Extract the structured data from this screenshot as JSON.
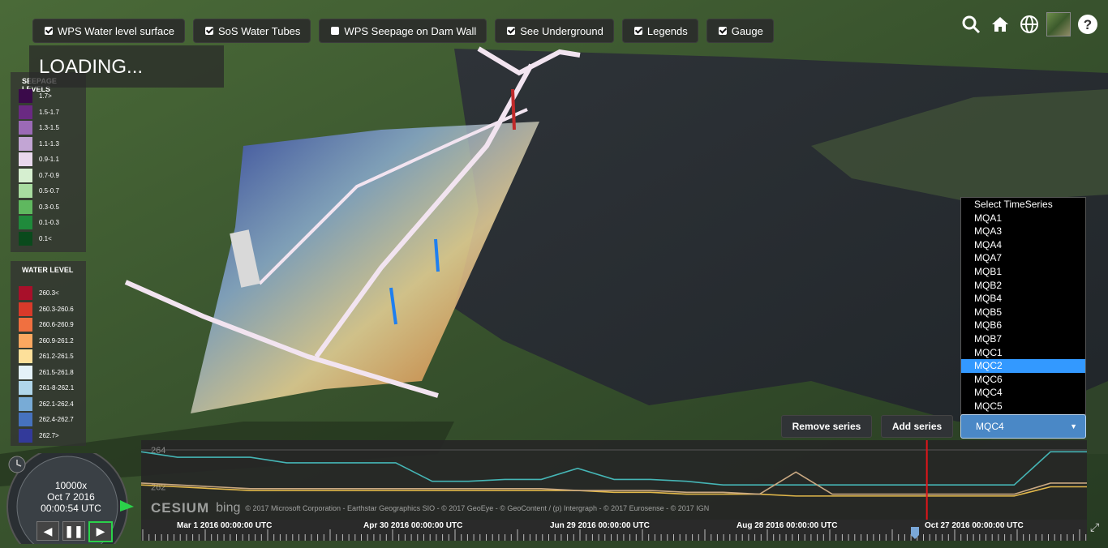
{
  "toolbar": {
    "buttons": [
      {
        "label": "WPS Water level surface",
        "checked": true
      },
      {
        "label": "SoS Water Tubes",
        "checked": true
      },
      {
        "label": "WPS Seepage on Dam Wall",
        "checked": false
      },
      {
        "label": "See Underground",
        "checked": true
      },
      {
        "label": "Legends",
        "checked": true
      },
      {
        "label": "Gauge",
        "checked": true
      }
    ]
  },
  "loading_text": "LOADING...",
  "seepage_legend": {
    "title": "SEEPAGE LEVELS",
    "items": [
      {
        "label": "1.7>",
        "color": "#3a0a4a"
      },
      {
        "label": "1.5-1.7",
        "color": "#6a2a82"
      },
      {
        "label": "1.3-1.5",
        "color": "#9b6ab6"
      },
      {
        "label": "1.1-1.3",
        "color": "#c2a5d4"
      },
      {
        "label": "0.9-1.1",
        "color": "#e8d8ec"
      },
      {
        "label": "0.7-0.9",
        "color": "#d6efd0"
      },
      {
        "label": "0.5-0.7",
        "color": "#a8dca0"
      },
      {
        "label": "0.3-0.5",
        "color": "#5fb85f"
      },
      {
        "label": "0.1-0.3",
        "color": "#1f8a3b"
      },
      {
        "label": "0.1<",
        "color": "#0a4a1c"
      }
    ]
  },
  "water_legend": {
    "title": "WATER LEVEL",
    "items": [
      {
        "label": "260.3<",
        "color": "#a8102a"
      },
      {
        "label": "260.3-260.6",
        "color": "#d83a2a"
      },
      {
        "label": "260.6-260.9",
        "color": "#f07040"
      },
      {
        "label": "260.9-261.2",
        "color": "#fba860"
      },
      {
        "label": "261.2-261.5",
        "color": "#fde09a"
      },
      {
        "label": "261.5-261.8",
        "color": "#e4f2f8"
      },
      {
        "label": "261-8-262.1",
        "color": "#b0d6ea"
      },
      {
        "label": "262.1-262.4",
        "color": "#78abd6"
      },
      {
        "label": "262.4-262.7",
        "color": "#4672be"
      },
      {
        "label": "262.7>",
        "color": "#333a9a"
      }
    ]
  },
  "top_icons": [
    "search-icon",
    "home-icon",
    "globe-icon",
    "imagery-icon",
    "help-icon"
  ],
  "timeseries": {
    "options": [
      "Select TimeSeries",
      "MQA1",
      "MQA3",
      "MQA4",
      "MQA7",
      "MQB1",
      "MQB2",
      "MQB4",
      "MQB5",
      "MQB6",
      "MQB7",
      "MQC1",
      "MQC2",
      "MQC6",
      "MQC4",
      "MQC5"
    ],
    "highlighted": "MQC2",
    "selected": "MQC4",
    "remove_label": "Remove series",
    "add_label": "Add series"
  },
  "chart_data": {
    "type": "line",
    "ylim": [
      260,
      264
    ],
    "y_ticks": [
      "264",
      "262"
    ],
    "x": [
      0,
      1,
      2,
      3,
      4,
      5,
      6,
      7,
      8,
      9,
      10,
      11,
      12,
      13,
      14,
      15,
      16,
      17,
      18,
      19,
      20,
      21,
      22,
      23,
      24,
      25,
      26
    ],
    "series": [
      {
        "color": "#45b5b5",
        "values": [
          263.9,
          263.6,
          263.6,
          263.6,
          263.3,
          263.3,
          263.3,
          263.3,
          262.3,
          262.3,
          262.4,
          262.4,
          263.0,
          262.4,
          262.4,
          262.3,
          262.1,
          262.1,
          262.1,
          262.1,
          262.1,
          262.1,
          262.1,
          262.1,
          262.1,
          263.9,
          263.9
        ]
      },
      {
        "color": "#e2b84a",
        "values": [
          262.1,
          262.0,
          261.9,
          261.8,
          261.8,
          261.8,
          261.8,
          261.8,
          261.8,
          261.8,
          261.8,
          261.8,
          261.8,
          261.7,
          261.7,
          261.6,
          261.6,
          261.6,
          261.5,
          261.5,
          261.5,
          261.5,
          261.5,
          261.5,
          261.5,
          262.0,
          262.0
        ]
      },
      {
        "color": "#c9a882",
        "values": [
          262.2,
          262.1,
          262.0,
          261.9,
          261.9,
          261.9,
          261.9,
          261.9,
          261.9,
          261.9,
          261.9,
          261.9,
          261.8,
          261.8,
          261.8,
          261.7,
          261.7,
          261.6,
          262.8,
          261.6,
          261.6,
          261.6,
          261.6,
          261.6,
          261.6,
          262.2,
          262.2
        ]
      }
    ],
    "current_x": 21.6
  },
  "timeline": {
    "labels": [
      "Mar 1 2016 00:00:00 UTC",
      "Apr 30 2016 00:00:00 UTC",
      "Jun 29 2016 00:00:00 UTC",
      "Aug 28 2016 00:00:00 UTC",
      "Oct 27 2016 00:00:00 UTC"
    ]
  },
  "animation": {
    "speed": "10000x",
    "date": "Oct 7 2016",
    "time": "00:00:54 UTC"
  },
  "credits": {
    "logo": "CESIUM",
    "bing": "bing",
    "text": "© 2017 Microsoft Corporation - Earthstar Geographics SIO - © 2017 GeoEye - © GeoContent / (p) Intergraph - © 2017 Eurosense - © 2017 IGN"
  }
}
